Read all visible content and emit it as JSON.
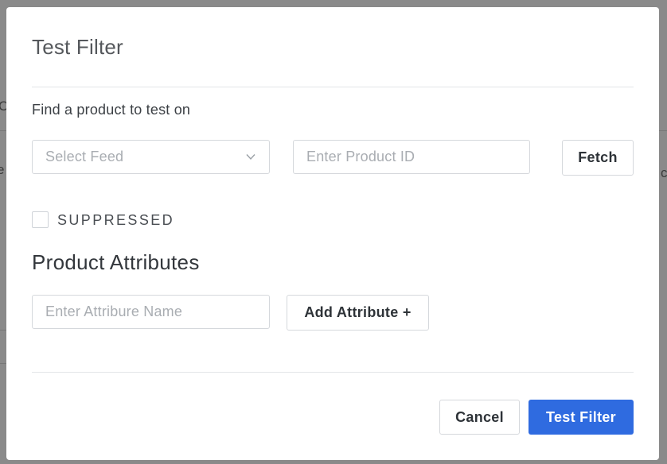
{
  "modal": {
    "title": "Test Filter",
    "find_label": "Find a product to test on",
    "feed_select": {
      "placeholder": "Select Feed"
    },
    "product_id_input": {
      "placeholder": "Enter Product ID"
    },
    "fetch_label": "Fetch",
    "suppressed_label": "SUPPRESSED",
    "suppressed_checked": false,
    "attributes_heading": "Product Attributes",
    "attribute_name_input": {
      "placeholder": "Enter Attribure Name"
    },
    "add_attribute_label": "Add Attribute +",
    "cancel_label": "Cancel",
    "submit_label": "Test Filter"
  },
  "colors": {
    "primary": "#2f6be0",
    "backdrop": "#8a8a8a",
    "border": "#d5d8dc"
  },
  "icons": {
    "feed_select": "chevron-down-icon"
  }
}
